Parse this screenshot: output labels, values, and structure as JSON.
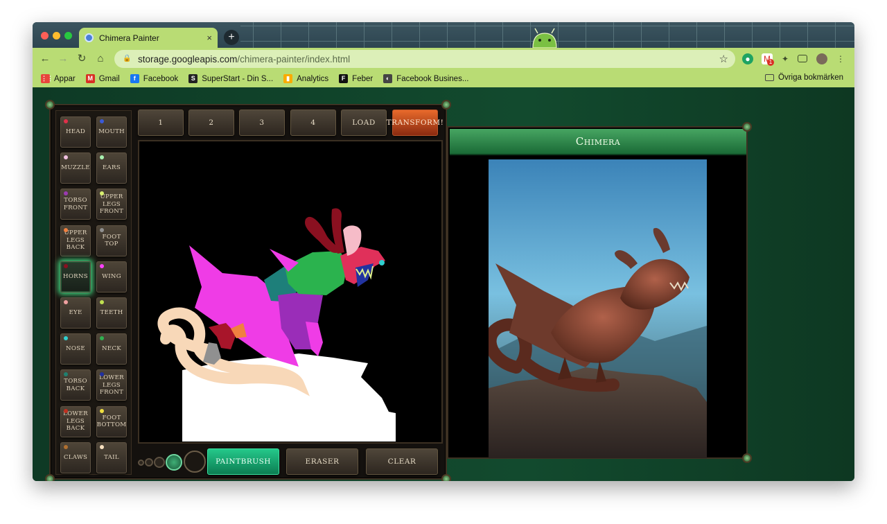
{
  "browser": {
    "tab_title": "Chimera Painter",
    "tab_close": "×",
    "new_tab": "+",
    "url_host": "storage.googleapis.com",
    "url_path": "/chimera-painter/index.html",
    "bookmarks": [
      {
        "label": "Appar",
        "icon": "apps-grid-icon",
        "color": "#e8453c"
      },
      {
        "label": "Gmail",
        "icon": "gmail-icon",
        "color": "#d93025"
      },
      {
        "label": "Facebook",
        "icon": "facebook-icon",
        "color": "#1877f2"
      },
      {
        "label": "SuperStart - Din S...",
        "icon": "superstart-icon",
        "color": "#222222"
      },
      {
        "label": "Analytics",
        "icon": "analytics-icon",
        "color": "#f9ab00"
      },
      {
        "label": "Feber",
        "icon": "feber-icon",
        "color": "#111111"
      },
      {
        "label": "Facebook Busines...",
        "icon": "facebook-business-icon",
        "color": "#444444"
      }
    ],
    "other_bookmarks": "Övriga bokmärken",
    "gmail_badge": "1"
  },
  "painter": {
    "parts": [
      {
        "label": "HEAD",
        "color": "#e0304a"
      },
      {
        "label": "MOUTH",
        "color": "#3a5ad8"
      },
      {
        "label": "MUZZLE",
        "color": "#f0c0e0"
      },
      {
        "label": "EARS",
        "color": "#a8f0b0"
      },
      {
        "label": "TORSO FRONT",
        "color": "#9a3ab0"
      },
      {
        "label": "UPPER LEGS FRONT",
        "color": "#d8f070"
      },
      {
        "label": "UPPER LEGS BACK",
        "color": "#f08040"
      },
      {
        "label": "FOOT TOP",
        "color": "#909090"
      },
      {
        "label": "HORNS",
        "color": "#8a1020"
      },
      {
        "label": "WING",
        "color": "#ff40ff"
      },
      {
        "label": "EYE",
        "color": "#f0a0a0"
      },
      {
        "label": "TEETH",
        "color": "#c0e050"
      },
      {
        "label": "NOSE",
        "color": "#30d0d0"
      },
      {
        "label": "NECK",
        "color": "#30b050"
      },
      {
        "label": "TORSO BACK",
        "color": "#208070"
      },
      {
        "label": "LOWER LEGS FRONT",
        "color": "#2030a0"
      },
      {
        "label": "LOWER LEGS BACK",
        "color": "#c03020"
      },
      {
        "label": "FOOT BOTTOM",
        "color": "#f0e040"
      },
      {
        "label": "CLAWS",
        "color": "#b07030"
      },
      {
        "label": "TAIL",
        "color": "#f8e0c0"
      }
    ],
    "active_part": "HORNS",
    "top_buttons": [
      "1",
      "2",
      "3",
      "4",
      "LOAD",
      "TRANSFORM!"
    ],
    "bottom_buttons": [
      "PAINTBRUSH",
      "ERASER",
      "CLEAR"
    ],
    "active_tool": "PAINTBRUSH"
  },
  "output": {
    "title": "Chimera"
  }
}
